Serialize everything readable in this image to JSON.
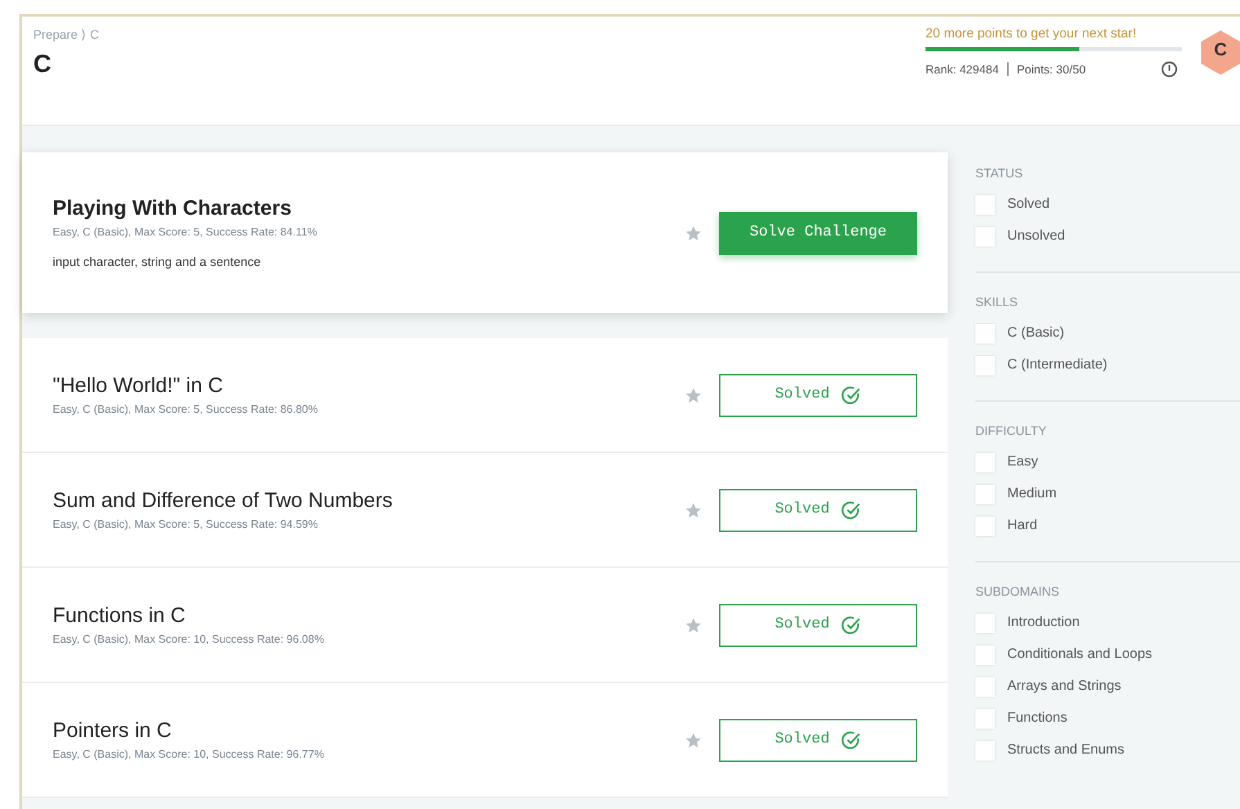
{
  "header": {
    "breadcrumb": "Prepare ⟩ C",
    "title": "C",
    "star_message": "20 more points to get your next star!",
    "progress": {
      "level": 0.6
    },
    "rank": "Rank: 429484",
    "points": "Points: 30/50",
    "badge": "C"
  },
  "challenges": [
    {
      "title": "Playing With Characters",
      "meta": "Easy, C (Basic), Max Score: 5, Success Rate: 84.11%",
      "description": "input character, string and a sentence",
      "featured": true,
      "action": {
        "kind": "solve",
        "label": "Solve Challenge"
      }
    },
    {
      "title": "\"Hello World!\" in C",
      "meta": "Easy, C (Basic), Max Score: 5, Success Rate: 86.80%",
      "featured": false,
      "action": {
        "kind": "solved",
        "label": "Solved"
      }
    },
    {
      "title": "Sum and Difference of Two Numbers",
      "meta": "Easy, C (Basic), Max Score: 5, Success Rate: 94.59%",
      "featured": false,
      "action": {
        "kind": "solved",
        "label": "Solved"
      }
    },
    {
      "title": "Functions in C",
      "meta": "Easy, C (Basic), Max Score: 10, Success Rate: 96.08%",
      "featured": false,
      "action": {
        "kind": "solved",
        "label": "Solved"
      }
    },
    {
      "title": "Pointers in C",
      "meta": "Easy, C (Basic), Max Score: 10, Success Rate: 96.77%",
      "featured": false,
      "action": {
        "kind": "solved",
        "label": "Solved"
      }
    }
  ],
  "filters": [
    {
      "heading": "STATUS",
      "options": [
        {
          "label": "Solved",
          "checked": false
        },
        {
          "label": "Unsolved",
          "checked": false
        }
      ]
    },
    {
      "heading": "SKILLS",
      "options": [
        {
          "label": "C (Basic)",
          "checked": false
        },
        {
          "label": "C (Intermediate)",
          "checked": false
        }
      ]
    },
    {
      "heading": "DIFFICULTY",
      "options": [
        {
          "label": "Easy",
          "checked": false
        },
        {
          "label": "Medium",
          "checked": false
        },
        {
          "label": "Hard",
          "checked": false
        }
      ]
    },
    {
      "heading": "SUBDOMAINS",
      "options": [
        {
          "label": "Introduction",
          "checked": false
        },
        {
          "label": "Conditionals and Loops",
          "checked": false
        },
        {
          "label": "Arrays and Strings",
          "checked": false
        },
        {
          "label": "Functions",
          "checked": false
        },
        {
          "label": "Structs and Enums",
          "checked": false
        }
      ]
    }
  ]
}
